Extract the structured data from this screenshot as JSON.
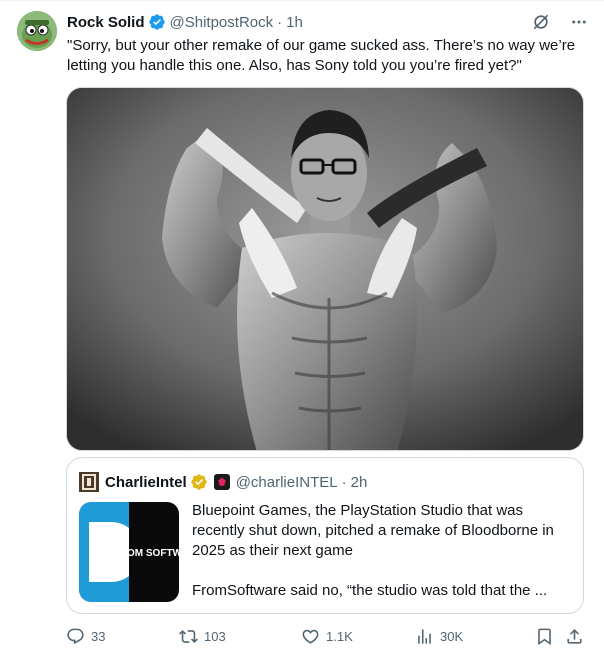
{
  "tweet": {
    "author": {
      "display_name": "Rock Solid",
      "handle": "@ShitpostRock",
      "time": "1h",
      "separator": "·"
    },
    "text": "\"Sorry, but your other remake of our game sucked ass. There’s no way we’re letting you handle this one. Also, has Sony told you you’re fired yet?\"",
    "icons": {
      "grok": "grok-icon",
      "more": "more-icon",
      "verified": "verified-badge-icon"
    }
  },
  "quote": {
    "author": {
      "display_name": "CharlieIntel",
      "handle": "@charlieINTEL",
      "time": "2h",
      "separator": "·"
    },
    "paragraph_1": "Bluepoint Games, the PlayStation Studio that was recently shut down, pitched a remake of Bloodborne in 2025 as their next game",
    "paragraph_2": "FromSoftware said no, “the studio was told that the ...",
    "thumb_text": "OM SOFTWA"
  },
  "actions": {
    "replies": "33",
    "reposts": "103",
    "likes": "1.1K",
    "views": "30K"
  },
  "colors": {
    "text": "#0f1419",
    "secondary": "#536471",
    "border": "#cfd9de",
    "verified_blue": "#1d9bf0",
    "verified_gold": "#e2b719",
    "thumb_blue": "#1e9ad6"
  }
}
